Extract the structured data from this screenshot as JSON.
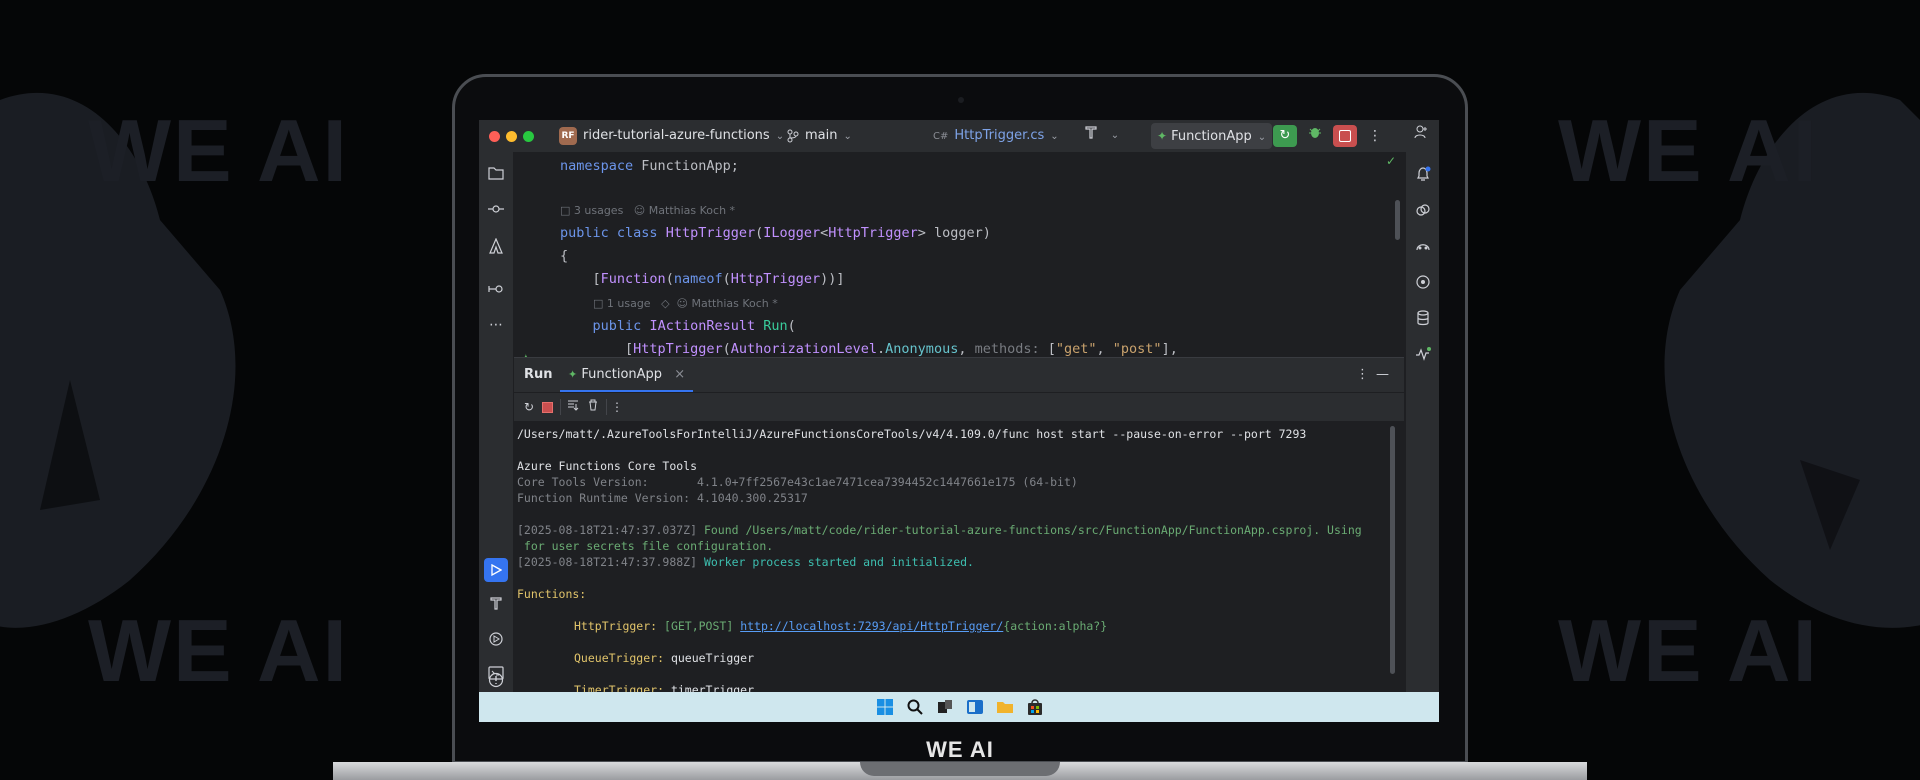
{
  "background": {
    "brand": "WE AI",
    "colors": {
      "bg": "#050607",
      "watermark": "#1c1f26"
    }
  },
  "laptop": {
    "bottom_logo": "WE AI"
  },
  "titlebar": {
    "project_chip": "RF",
    "project_name": "rider-tutorial-azure-functions",
    "branch": "main",
    "file_chip": "C#",
    "file_name": "HttpTrigger.cs",
    "run_config": "FunctionApp",
    "icons": [
      "hammer-icon",
      "run-icon",
      "debug-icon",
      "stop-icon",
      "more-icon",
      "add-user-icon"
    ]
  },
  "left_strip": {
    "top_icons": [
      "folder-icon",
      "commit-icon",
      "azure-icon",
      "structure-icon",
      "more-icon"
    ],
    "bottom_icons": [
      "run-icon",
      "build-icon",
      "services-icon",
      "terminal-icon",
      "problems-icon"
    ]
  },
  "right_strip": {
    "icons": [
      "notifications-icon",
      "ai-icon",
      "copilot-icon",
      "endpoints-icon",
      "database-icon",
      "profiler-icon"
    ]
  },
  "editor": {
    "lines": {
      "l1_kw": "namespace",
      "l1_name": "FunctionApp",
      "l1_end": ";",
      "usages1": "3 usages",
      "author1": "Matthias Koch *",
      "l2_kw1": "public",
      "l2_kw2": "class",
      "l2_name": "HttpTrigger",
      "l2_p1": "(",
      "l2_type": "ILogger",
      "l2_gen1": "<",
      "l2_gen_arg": "HttpTrigger",
      "l2_gen2": ">",
      "l2_param": " logger",
      "l2_p2": ")",
      "l3": "{",
      "l4_b1": "[",
      "l4_attr": "Function",
      "l4_p1": "(",
      "l4_kw": "nameof",
      "l4_p2": "(",
      "l4_arg": "HttpTrigger",
      "l4_end": "))]",
      "usages2": "1 usage",
      "author2": "Matthias Koch *",
      "l5_kw": "public",
      "l5_type": "IActionResult",
      "l5_name": "Run",
      "l5_p": "(",
      "l6_b": "[",
      "l6_attr": "HttpTrigger",
      "l6_p": "(",
      "l6_enum": "AuthorizationLevel",
      "l6_dot": ".",
      "l6_member": "Anonymous",
      "l6_comma": ", ",
      "l6_named": "methods:",
      "l6_arr1": " [",
      "l6_s1": "\"get\"",
      "l6_c2": ", ",
      "l6_s2": "\"post\"",
      "l6_end": "],"
    }
  },
  "run_panel": {
    "title": "Run",
    "tab": "FunctionApp",
    "tab_close": "×",
    "toolbar_icons": [
      "rerun-icon",
      "stop-icon",
      "scroll-to-end-icon",
      "clear-icon",
      "more-icon"
    ],
    "console": {
      "cmd": "/Users/matt/.AzureToolsForIntelliJ/AzureFunctionsCoreTools/v4/4.109.0/func host start --pause-on-error --port 7293",
      "header": "Azure Functions Core Tools",
      "core_label": "Core Tools Version:       ",
      "core_value": "4.1.0+7ff2567e43c1ae7471cea7394452c1447661e175 (64-bit)",
      "runtime_label": "Function Runtime Version: ",
      "runtime_value": "4.1040.300.25317",
      "ts1": "[2025-08-18T21:47:37.037Z]",
      "msg1a": " Found /Users/matt/code/rider-tutorial-azure-functions/src/FunctionApp/FunctionApp.csproj. Using",
      "msg1b": " for user secrets file configuration.",
      "ts2": "[2025-08-18T21:47:37.988Z]",
      "msg2": " Worker process started and initialized.",
      "functions_label": "Functions:",
      "f1_name": "HttpTrigger:",
      "f1_methods": " [GET,POST] ",
      "f1_url": "http://localhost:7293/api/HttpTrigger/",
      "f1_route": "{action:alpha?}",
      "f2_name": "QueueTrigger:",
      "f2_type": " queueTrigger",
      "f3_name": "TimerTrigger:",
      "f3_type": " timerTrigger"
    }
  },
  "taskbar": {
    "icons": [
      "windows-start-icon",
      "search-icon",
      "task-view-icon",
      "widgets-icon",
      "file-explorer-icon",
      "store-icon"
    ],
    "colors": {
      "bg": "#cfe7ee"
    }
  }
}
